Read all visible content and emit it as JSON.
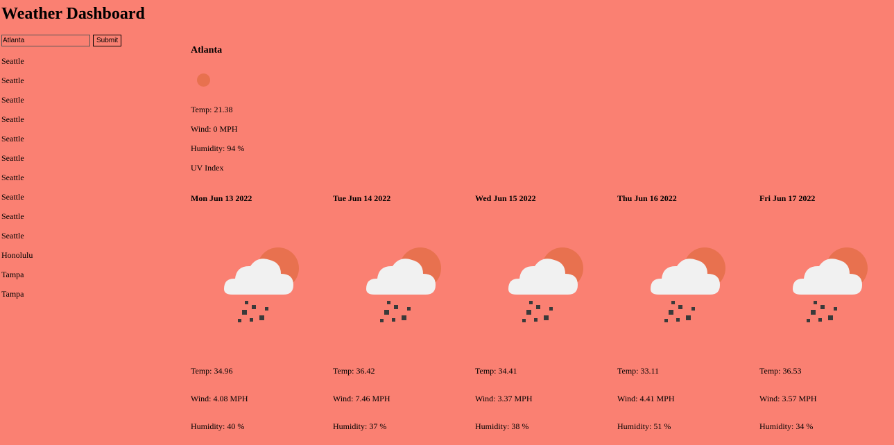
{
  "header": {
    "title": "Weather Dashboard"
  },
  "search": {
    "value": "Atlanta",
    "submit_label": "Submit"
  },
  "history": [
    "Seattle",
    "Seattle",
    "Seattle",
    "Seattle",
    "Seattle",
    "Seattle",
    "Seattle",
    "Seattle",
    "Seattle",
    "Seattle",
    "Honolulu",
    "Tampa",
    "Tampa"
  ],
  "current": {
    "city": "Atlanta",
    "icon": "sun-icon",
    "temp": "Temp: 21.38",
    "wind": "Wind: 0 MPH",
    "humidity": "Humidity: 94 %",
    "uv": "UV Index"
  },
  "forecast": [
    {
      "date": "Mon Jun 13 2022",
      "icon": "cloud-sun-snow-icon",
      "temp": "Temp: 34.96",
      "wind": "Wind: 4.08 MPH",
      "humidity": "Humidity: 40 %"
    },
    {
      "date": "Tue Jun 14 2022",
      "icon": "cloud-sun-snow-icon",
      "temp": "Temp: 36.42",
      "wind": "Wind: 7.46 MPH",
      "humidity": "Humidity: 37 %"
    },
    {
      "date": "Wed Jun 15 2022",
      "icon": "cloud-sun-snow-icon",
      "temp": "Temp: 34.41",
      "wind": "Wind: 3.37 MPH",
      "humidity": "Humidity: 38 %"
    },
    {
      "date": "Thu Jun 16 2022",
      "icon": "cloud-sun-snow-icon",
      "temp": "Temp: 33.11",
      "wind": "Wind: 4.41 MPH",
      "humidity": "Humidity: 51 %"
    },
    {
      "date": "Fri Jun 17 2022",
      "icon": "cloud-sun-snow-icon",
      "temp": "Temp: 36.53",
      "wind": "Wind: 3.57 MPH",
      "humidity": "Humidity: 34 %"
    }
  ],
  "colors": {
    "background": "#FA8072",
    "sun": "#E8714F",
    "cloud": "#F1F1F1",
    "snow": "#3A3A3A"
  }
}
